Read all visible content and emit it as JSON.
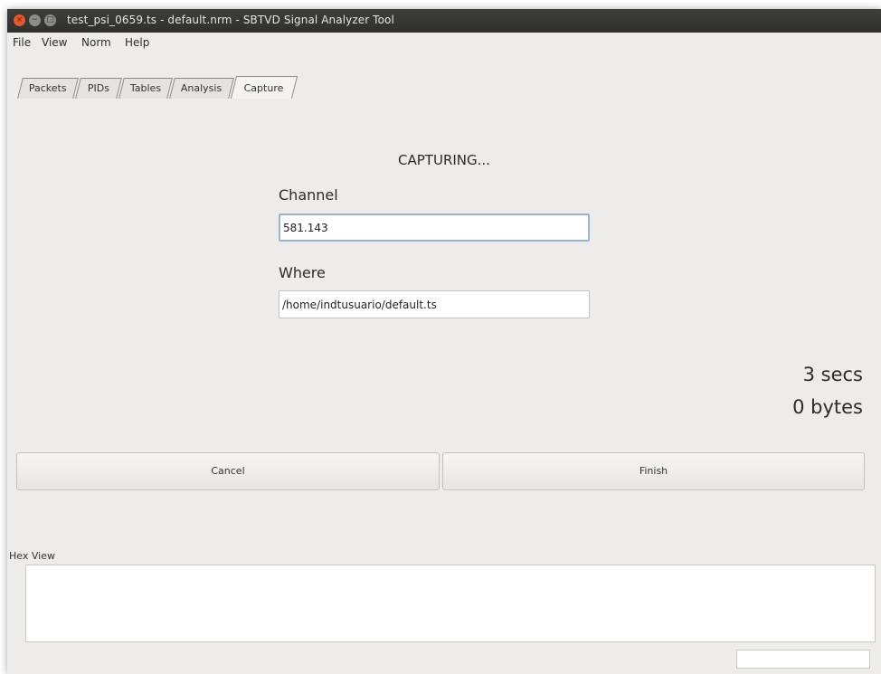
{
  "window": {
    "title": "test_psi_0659.ts - default.nrm - SBTVD Signal Analyzer Tool",
    "controls": {
      "close": "×",
      "minimize": "−",
      "maximize": "□"
    }
  },
  "menu": [
    "File",
    "View",
    "Norm",
    "Help"
  ],
  "tabs": [
    {
      "label": "Packets",
      "active": false
    },
    {
      "label": "PIDs",
      "active": false
    },
    {
      "label": "Tables",
      "active": false
    },
    {
      "label": "Analysis",
      "active": false
    },
    {
      "label": "Capture",
      "active": true
    }
  ],
  "capture": {
    "status": "CAPTURING...",
    "channel_label": "Channel",
    "channel_value": "581.143",
    "where_label": "Where",
    "where_value": "/home/indtusuario/default.ts",
    "elapsed": "3 secs",
    "bytes": "0 bytes",
    "cancel_label": "Cancel",
    "finish_label": "Finish"
  },
  "hex_view": {
    "label": "Hex View"
  },
  "colors": {
    "titlebar": "#3e3e3b",
    "window_bg": "#edecea",
    "close_button": "#e4572e",
    "focus_border": "#9ab4cf"
  }
}
